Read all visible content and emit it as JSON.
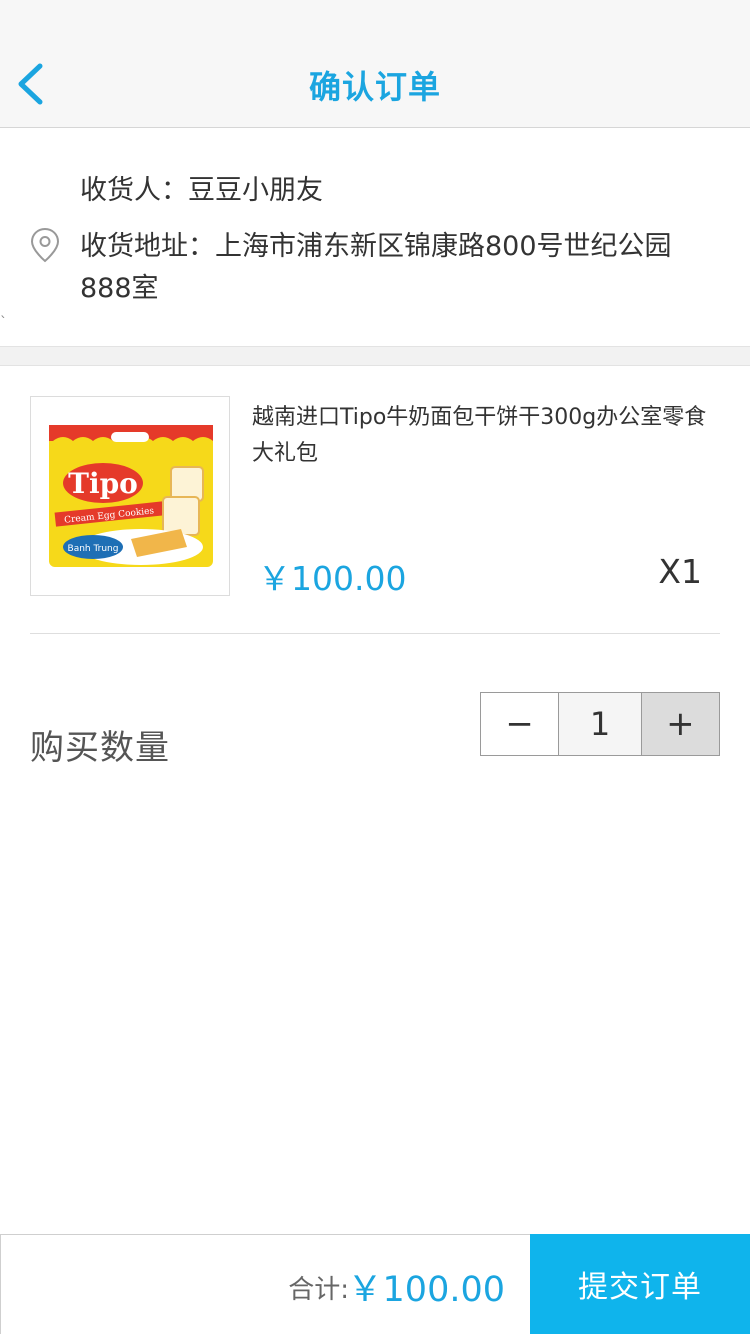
{
  "header": {
    "title": "确认订单",
    "back_icon": "chevron-left-icon"
  },
  "address": {
    "receiver": "收货人：豆豆小朋友",
    "address_text": "收货地址：上海市浦东新区锦康路800号世纪公园888室",
    "location_icon": "location-pin-icon",
    "tick": "`"
  },
  "product": {
    "name": "越南进口Tipo牛奶面包干饼干300g办公室零食大礼包",
    "price": "￥100.00",
    "quantity_label": "X1",
    "image_brand_text": "Tipo",
    "image_caption": "Cream Egg Cookies",
    "image_badge": "Banh Trung"
  },
  "quantity": {
    "label": "购买数量",
    "minus": "−",
    "value": "1",
    "plus": "+"
  },
  "footer": {
    "total_label": "合计:",
    "total_value": "￥100.00",
    "submit_label": "提交订单"
  },
  "colors": {
    "accent": "#1ba5e0",
    "submit_bg": "#0fb4ec"
  }
}
